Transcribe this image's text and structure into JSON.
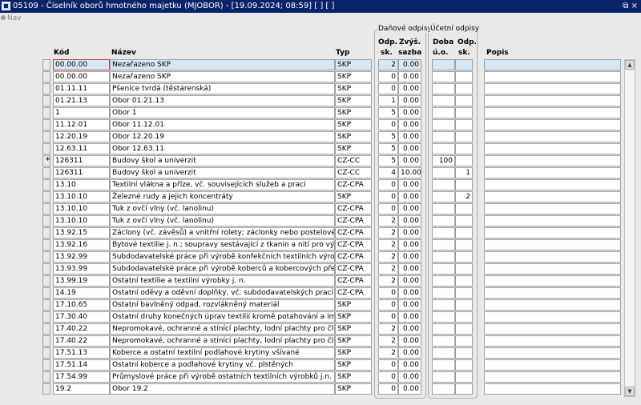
{
  "window": {
    "title": "05109 - Číselník oborů hmotného majetku (MJOBOR) - [19.09.2024; 08:59]  [ ]  [ ]",
    "controls": "⧉ ×"
  },
  "nav": {
    "label": "Nav"
  },
  "groups": {
    "danove": "Daňové odpisy",
    "ucetni": "Účetní odpisy"
  },
  "headers": {
    "kod": "Kód",
    "nazev": "Název",
    "typ": "Typ",
    "odp_sk_1": "Odp.",
    "odp_sk_2": "sk.",
    "zvys_1": "Zvýš.",
    "zvys_2": "sazba",
    "doba_1": "Doba",
    "doba_2": "ú.o.",
    "uodp_1": "Odp.",
    "uodp_2": "sk.",
    "popis": "Popis"
  },
  "rows": [
    {
      "marker": "",
      "kod": "00.00.00",
      "nazev": "Nezařazeno SKP",
      "typ": "SKP",
      "odp": "2",
      "zvys": "0.00",
      "doba": "",
      "usk": "",
      "popis": "",
      "selected": true,
      "focus": true
    },
    {
      "marker": "",
      "kod": "00.00.00",
      "nazev": "Nezařazeno SKP",
      "typ": "SKP",
      "odp": "0",
      "zvys": "0.00",
      "doba": "",
      "usk": "",
      "popis": ""
    },
    {
      "marker": "",
      "kod": "01.11.11",
      "nazev": "Pšenice tvrdá (těstárenská)",
      "typ": "SKP",
      "odp": "0",
      "zvys": "0.00",
      "doba": "",
      "usk": "",
      "popis": ""
    },
    {
      "marker": "",
      "kod": "01.21.13",
      "nazev": "Obor 01.21.13",
      "typ": "SKP",
      "odp": "1",
      "zvys": "0.00",
      "doba": "",
      "usk": "",
      "popis": ""
    },
    {
      "marker": "",
      "kod": "1",
      "nazev": "Obor 1",
      "typ": "SKP",
      "odp": "5",
      "zvys": "0.00",
      "doba": "",
      "usk": "",
      "popis": ""
    },
    {
      "marker": "",
      "kod": "11.12.01",
      "nazev": "Obor 11.12.01",
      "typ": "SKP",
      "odp": "0",
      "zvys": "0.00",
      "doba": "",
      "usk": "",
      "popis": ""
    },
    {
      "marker": "",
      "kod": "12.20.19",
      "nazev": "Obor 12.20.19",
      "typ": "SKP",
      "odp": "5",
      "zvys": "0.00",
      "doba": "",
      "usk": "",
      "popis": ""
    },
    {
      "marker": "",
      "kod": "12.63.11",
      "nazev": "Obor 12.63.11",
      "typ": "SKP",
      "odp": "5",
      "zvys": "0.00",
      "doba": "",
      "usk": "",
      "popis": ""
    },
    {
      "marker": "*",
      "kod": "126311",
      "nazev": "Budovy škol a univerzit",
      "typ": "CZ-CC",
      "odp": "5",
      "zvys": "0.00",
      "doba": "100",
      "usk": "",
      "popis": ""
    },
    {
      "marker": "",
      "kod": "126311",
      "nazev": "Budovy škol a univerzit",
      "typ": "CZ-CC",
      "odp": "4",
      "zvys": "10.00",
      "doba": "",
      "usk": "1",
      "popis": ""
    },
    {
      "marker": "",
      "kod": "13.10",
      "nazev": "Textilní vlákna a příze, vč. souvisejících služeb a prací",
      "typ": "CZ-CPA",
      "odp": "0",
      "zvys": "0.00",
      "doba": "",
      "usk": "",
      "popis": ""
    },
    {
      "marker": "",
      "kod": "13.10.10",
      "nazev": "Železné rudy a jejich koncentráty",
      "typ": "SKP",
      "odp": "0",
      "zvys": "0.00",
      "doba": "",
      "usk": "2",
      "popis": ""
    },
    {
      "marker": "",
      "kod": "13.10.10",
      "nazev": "Tuk z ovčí vlny (vč. lanolinu)",
      "typ": "CZ-CPA",
      "odp": "0",
      "zvys": "0.00",
      "doba": "",
      "usk": "",
      "popis": ""
    },
    {
      "marker": "",
      "kod": "13.10.10",
      "nazev": "Tuk z ovčí vlny (vč. lanolinu)",
      "typ": "CZ-CPA",
      "odp": "2",
      "zvys": "0.00",
      "doba": "",
      "usk": "",
      "popis": ""
    },
    {
      "marker": "",
      "kod": "13.92.15",
      "nazev": "Záclony (vč. závěsů) a vnitřní rolety; záclonky nebo postelové draperie",
      "typ": "CZ-CPA",
      "odp": "2",
      "zvys": "0.00",
      "doba": "",
      "usk": "",
      "popis": ""
    },
    {
      "marker": "",
      "kod": "13.92.16",
      "nazev": "Bytové textilie j. n.; soupravy sestávající z tkanin a nití pro výrobu koberců",
      "typ": "CZ-CPA",
      "odp": "2",
      "zvys": "0.00",
      "doba": "",
      "usk": "",
      "popis": ""
    },
    {
      "marker": "",
      "kod": "13.92.99",
      "nazev": "Subdodavatelské práce při výrobě konfekčních textilních výrobků, kromě",
      "typ": "CZ-CPA",
      "odp": "2",
      "zvys": "0.00",
      "doba": "",
      "usk": "",
      "popis": ""
    },
    {
      "marker": "",
      "kod": "13.93.99",
      "nazev": "Subdodavatelské práce při výrobě koberců a kobercových předložek",
      "typ": "CZ-CPA",
      "odp": "2",
      "zvys": "0.00",
      "doba": "",
      "usk": "",
      "popis": ""
    },
    {
      "marker": "",
      "kod": "13.99.19",
      "nazev": "Ostatní textilie a textilní výrobky j. n.",
      "typ": "CZ-CPA",
      "odp": "2",
      "zvys": "0.00",
      "doba": "",
      "usk": "",
      "popis": ""
    },
    {
      "marker": "",
      "kod": "14.19",
      "nazev": "Ostatní oděvy a oděvní doplňky, vč. subdodavatelských prací",
      "typ": "CZ-CPA",
      "odp": "0",
      "zvys": "0.00",
      "doba": "",
      "usk": "",
      "popis": ""
    },
    {
      "marker": "",
      "kod": "17.10.65",
      "nazev": "Ostatní bavlněný odpad, rozvlákněný materiál",
      "typ": "SKP",
      "odp": "0",
      "zvys": "0.00",
      "doba": "",
      "usk": "",
      "popis": ""
    },
    {
      "marker": "",
      "kod": "17.30.40",
      "nazev": "Ostatní druhy konečných úprav textilií kromě potahování a impregnace",
      "typ": "SKP",
      "odp": "0",
      "zvys": "0.00",
      "doba": "",
      "usk": "",
      "popis": ""
    },
    {
      "marker": "",
      "kod": "17.40.22",
      "nazev": "Nepromokavé, ochranné a stínící plachty, lodní plachty pro čluny, pro plachetní",
      "typ": "SKP",
      "odp": "2",
      "zvys": "0.00",
      "doba": "",
      "usk": "",
      "popis": ""
    },
    {
      "marker": "",
      "kod": "17.40.22",
      "nazev": "Nepromokavé, ochranné a stínící plachty, lodní plachty pro čluny, pro plachetní",
      "typ": "SKP",
      "odp": "2",
      "zvys": "0.00",
      "doba": "",
      "usk": "",
      "popis": ""
    },
    {
      "marker": "",
      "kod": "17.51.13",
      "nazev": "Koberce a ostatní textilní podlahové krytiny všívané",
      "typ": "SKP",
      "odp": "2",
      "zvys": "0.00",
      "doba": "",
      "usk": "",
      "popis": ""
    },
    {
      "marker": "",
      "kod": "17.51.14",
      "nazev": "Ostatní koberce a podlahové krytiny vč. plstěných",
      "typ": "SKP",
      "odp": "0",
      "zvys": "0.00",
      "doba": "",
      "usk": "",
      "popis": ""
    },
    {
      "marker": "",
      "kod": "17.54.99",
      "nazev": "Průmyslové práce při výrobě ostatních textilních výrobků j.n.",
      "typ": "SKP",
      "odp": "0",
      "zvys": "0.00",
      "doba": "",
      "usk": "",
      "popis": ""
    },
    {
      "marker": "",
      "kod": "19.2",
      "nazev": "Obor 19.2",
      "typ": "SKP",
      "odp": "0",
      "zvys": "0.00",
      "doba": "",
      "usk": "",
      "popis": ""
    }
  ],
  "colors": {
    "titlebar": "#0a246a",
    "selected_row": "#d6e8f8",
    "focus_border": "#d04040",
    "background": "#e9e9e9"
  },
  "icons": {
    "app": "app-icon",
    "nav": "nav-dot-icon",
    "scroll_up": "scroll-up-arrow-icon",
    "scroll_down": "scroll-down-arrow-icon"
  }
}
